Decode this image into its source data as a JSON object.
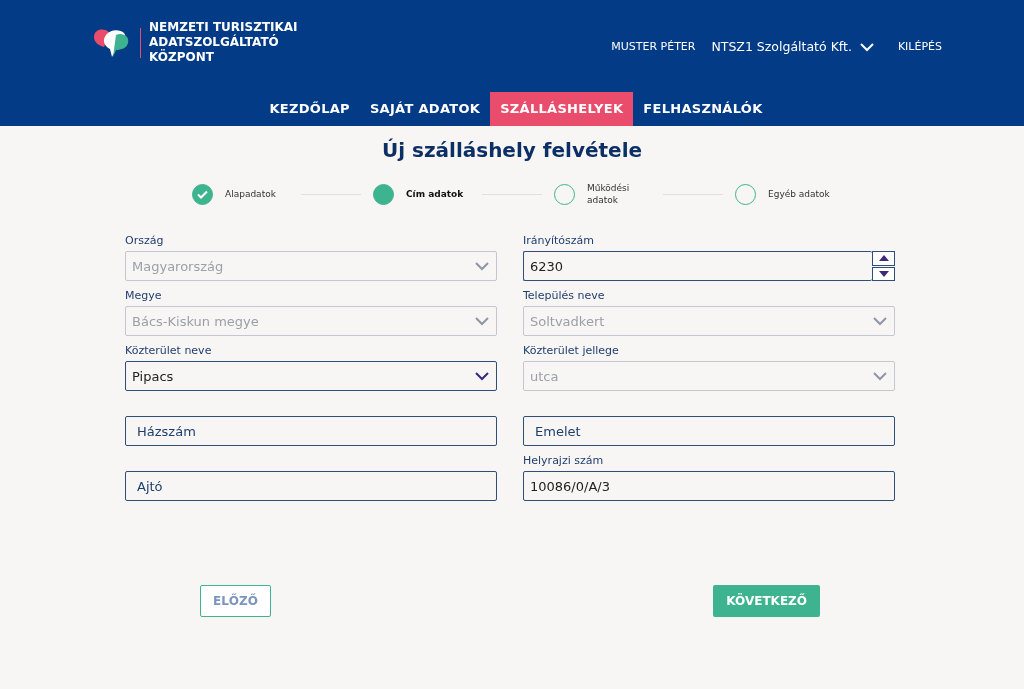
{
  "header": {
    "logo_text": [
      "NEMZETI TURISZTIKAI",
      "ADATSZOLGÁLTATÓ",
      "KÖZPONT"
    ],
    "user": "MUSTER PÉTER",
    "company": "NTSZ1 Szolgáltató Kft.",
    "logout": "KILÉPÉS"
  },
  "nav": [
    {
      "label": "KEZDŐLAP",
      "selected": false
    },
    {
      "label": "SAJÁT ADATOK",
      "selected": false
    },
    {
      "label": "SZÁLLÁSHELYEK",
      "selected": true
    },
    {
      "label": "FELHASZNÁLÓK",
      "selected": false
    }
  ],
  "title": "Új szálláshely felvétele",
  "steps": [
    {
      "label": "Alapadatok",
      "completed": true,
      "selected": false
    },
    {
      "label": "Cím adatok",
      "completed": false,
      "selected": true
    },
    {
      "label": "Működési adatok",
      "completed": false,
      "selected": false
    },
    {
      "label": "Egyéb adatok",
      "completed": false,
      "selected": false
    }
  ],
  "fields": [
    {
      "label": "Ország",
      "kind": "select",
      "value": "Magyarország",
      "disabled": true
    },
    {
      "label": "Irányítószám",
      "kind": "number",
      "value": "6230",
      "disabled": false
    },
    {
      "label": "Megye",
      "kind": "select",
      "value": "Bács-Kiskun megye",
      "disabled": true
    },
    {
      "label": "Település neve",
      "kind": "select",
      "value": "Soltvadkert",
      "disabled": true
    },
    {
      "label": "Közterület neve",
      "kind": "select",
      "value": "Pipacs",
      "disabled": false
    },
    {
      "label": "Közterület jellege",
      "kind": "select",
      "value": "utca",
      "disabled": true
    },
    {
      "kind": "text",
      "placeholder": "Házszám",
      "disabled": false
    },
    {
      "kind": "text",
      "placeholder": "Emelet",
      "disabled": false
    },
    {
      "kind": "text",
      "placeholder": "Ajtó",
      "disabled": false
    },
    {
      "label": "Helyrajzi szám",
      "kind": "text",
      "value": "10086/0/A/3",
      "disabled": false
    }
  ],
  "buttons": {
    "previous": "ELŐZŐ",
    "next": "KÖVETKEZŐ"
  }
}
